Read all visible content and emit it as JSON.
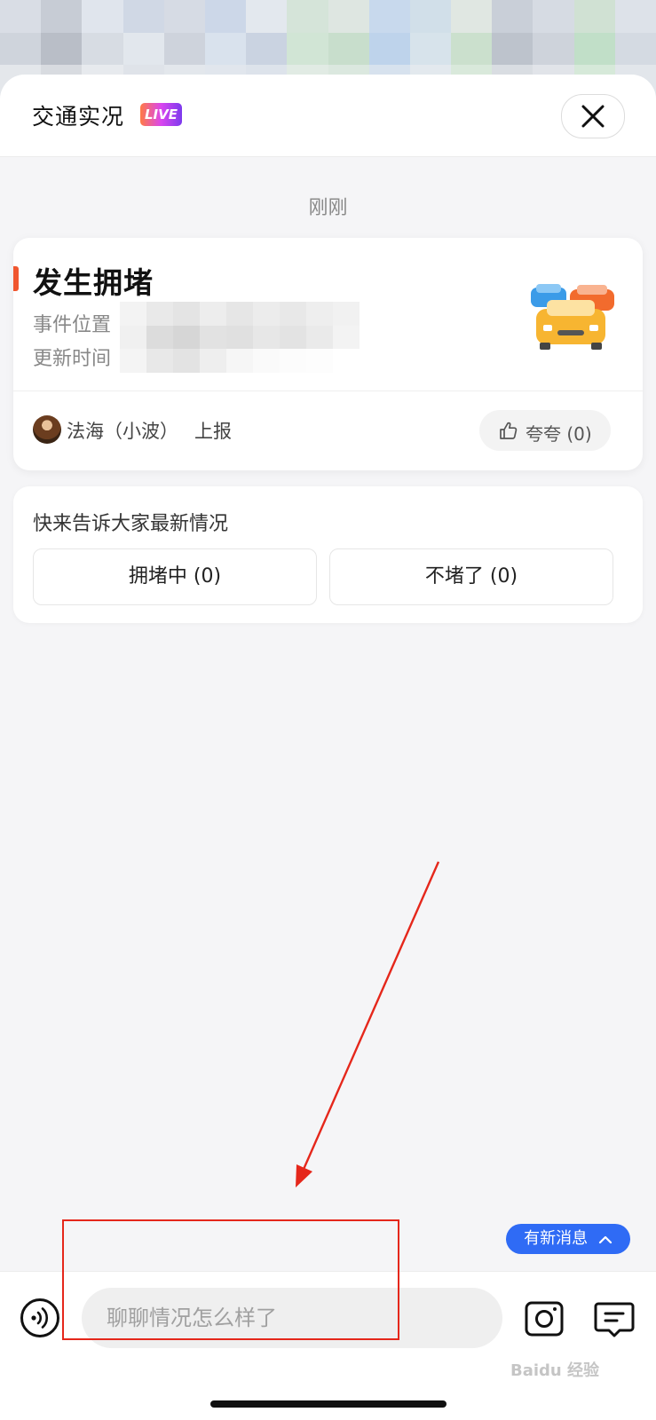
{
  "header": {
    "title": "交通实况",
    "live_badge": "LIVE"
  },
  "timestamp": "刚刚",
  "event": {
    "title": "发生拥堵",
    "location_label": "事件位置",
    "update_time_label": "更新时间",
    "reporter_name": "法海（小波）",
    "reporter_action": "上报",
    "praise_label": "夸夸 (0)",
    "accent_color": "#f0562f"
  },
  "feedback": {
    "prompt": "快来告诉大家最新情况",
    "jam_button": "拥堵中 (0)",
    "clear_button": "不堵了 (0)"
  },
  "new_messages_button": "有新消息",
  "input": {
    "placeholder": "聊聊情况怎么样了"
  },
  "watermark": "Baidu 经验",
  "colors": {
    "primary_blue": "#2f6bf5",
    "annotation_red": "#e5271b"
  }
}
